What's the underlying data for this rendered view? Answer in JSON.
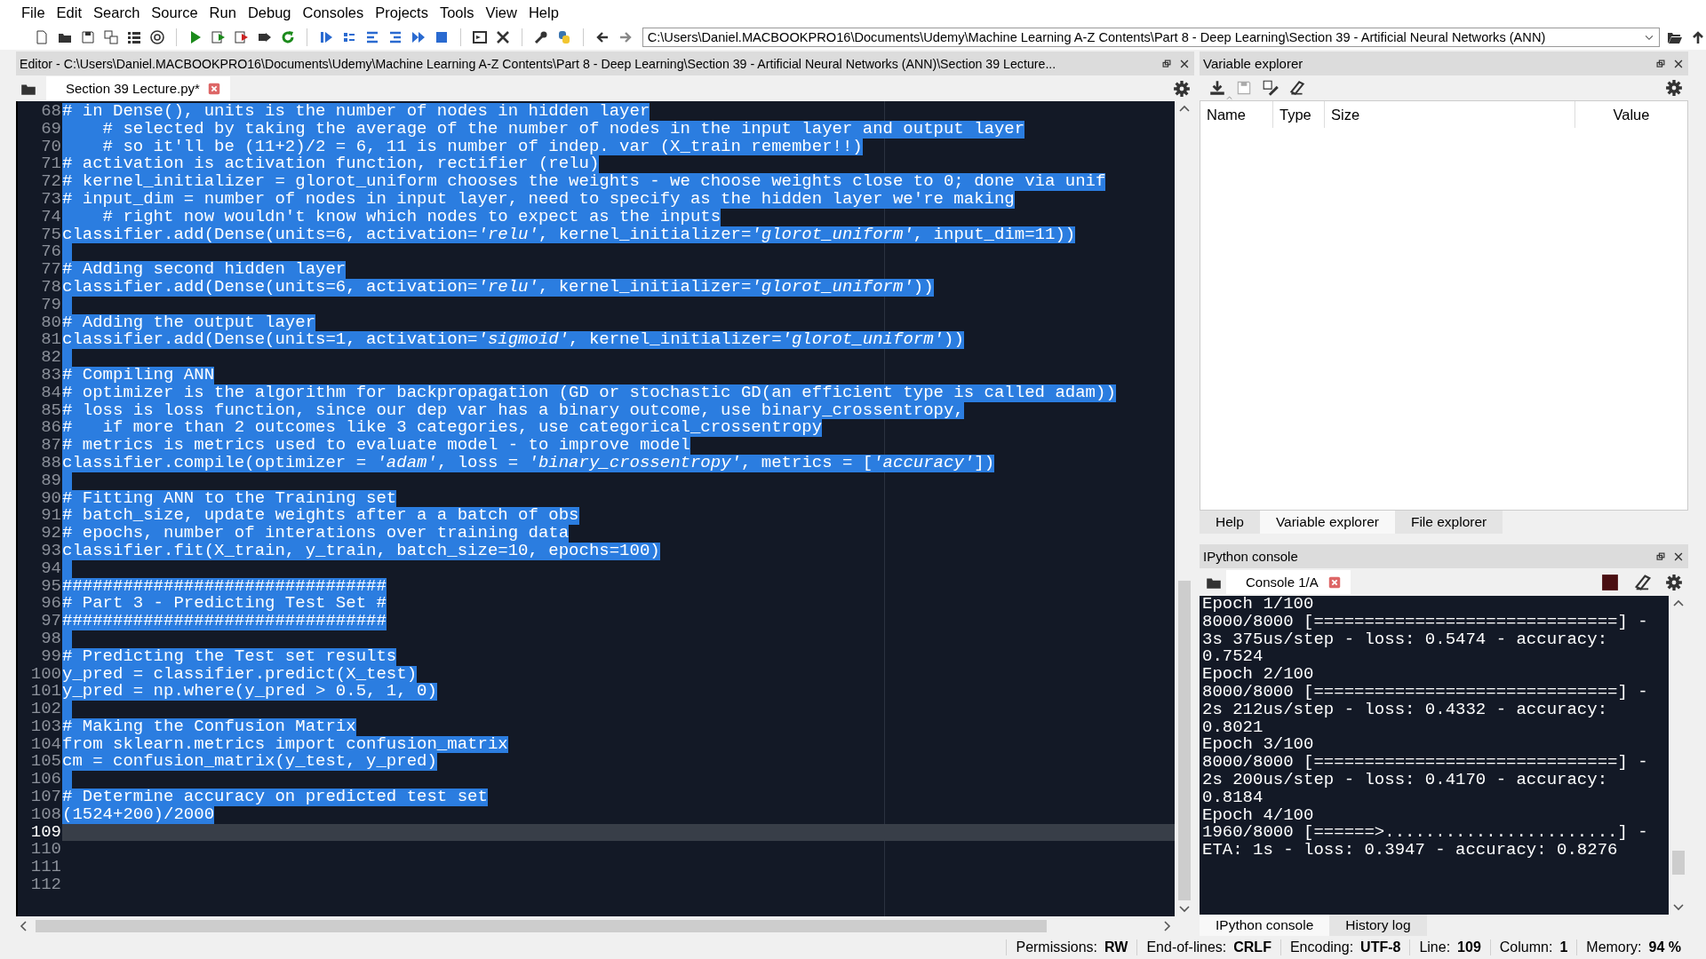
{
  "menu": [
    "File",
    "Edit",
    "Search",
    "Source",
    "Run",
    "Debug",
    "Consoles",
    "Projects",
    "Tools",
    "View",
    "Help"
  ],
  "path_field": {
    "value": "C:\\Users\\Daniel.MACBOOKPRO16\\Documents\\Udemy\\Machine Learning A-Z Contents\\Part 8 - Deep Learning\\Section 39 - Artificial Neural Networks (ANN)"
  },
  "editor": {
    "title": "Editor - C:\\Users\\Daniel.MACBOOKPRO16\\Documents\\Udemy\\Machine Learning A-Z Contents\\Part 8 - Deep Learning\\Section 39 - Artificial Neural Networks (ANN)\\Section 39 Lecture...",
    "tabs": [
      {
        "label": "Section 39 Lecture.py*",
        "selected": true
      }
    ],
    "lines": [
      {
        "number": "68",
        "text": "# in Dense(), units is the number of nodes in hidden layer",
        "selected": true,
        "current": false
      },
      {
        "number": "69",
        "text": "    # selected by taking the average of the number of nodes in the input layer and output layer",
        "selected": true,
        "current": false
      },
      {
        "number": "70",
        "text": "    # so it'll be (11+2)/2 = 6, 11 is number of indep. var (X_train remember!!)",
        "selected": true,
        "current": false
      },
      {
        "number": "71",
        "text": "# activation is activation function, rectifier (relu)",
        "selected": true,
        "current": false
      },
      {
        "number": "72",
        "text": "# kernel_initializer = glorot_uniform chooses the weights - we choose weights close to 0; done via unif",
        "selected": true,
        "current": false
      },
      {
        "number": "73",
        "text": "# input_dim = number of nodes in input layer, need to specify as the hidden layer we're making",
        "selected": true,
        "current": false
      },
      {
        "number": "74",
        "text": "    # right now wouldn't know which nodes to expect as the inputs",
        "selected": true,
        "current": false
      },
      {
        "number": "75",
        "text": "classifier.add(Dense(units=6, activation=*'relu'*, kernel_initializer=*'glorot_uniform'*, input_dim=11))",
        "selected": true,
        "current": false
      },
      {
        "number": "76",
        "selected": true,
        "current": false
      },
      {
        "number": "77",
        "text": "# Adding second hidden layer",
        "selected": true,
        "current": false
      },
      {
        "number": "78",
        "text": "classifier.add(Dense(units=6, activation=*'relu'*, kernel_initializer=*'glorot_uniform'*))",
        "selected": true,
        "current": false
      },
      {
        "number": "79",
        "selected": true,
        "current": false
      },
      {
        "number": "80",
        "text": "# Adding the output layer",
        "selected": true,
        "current": false
      },
      {
        "number": "81",
        "text": "classifier.add(Dense(units=1, activation=*'sigmoid'*, kernel_initializer=*'glorot_uniform'*))",
        "selected": true,
        "current": false
      },
      {
        "number": "82",
        "selected": true,
        "current": false
      },
      {
        "number": "83",
        "text": "# Compiling ANN",
        "selected": true,
        "current": false
      },
      {
        "number": "84",
        "text": "# optimizer is the algorithm for backpropagation (GD or stochastic GD(an efficient type is called adam))",
        "selected": true,
        "current": false
      },
      {
        "number": "85",
        "text": "# loss is loss function, since our dep var has a binary outcome, use binary_crossentropy,",
        "selected": true,
        "current": false
      },
      {
        "number": "86",
        "text": "#   if more than 2 outcomes like 3 categories, use categorical_crossentropy",
        "selected": true,
        "current": false
      },
      {
        "number": "87",
        "text": "# metrics is metrics used to evaluate model - to improve model",
        "selected": true,
        "current": false
      },
      {
        "number": "88",
        "text": "classifier.compile(optimizer = *'adam'*, loss = *'binary_crossentropy'*, metrics = [*'accuracy'*])",
        "selected": true,
        "current": false
      },
      {
        "number": "89",
        "selected": true,
        "current": false
      },
      {
        "number": "90",
        "text": "# Fitting ANN to the Training set",
        "selected": true,
        "current": false
      },
      {
        "number": "91",
        "text": "# batch_size, update weights after a a batch of obs",
        "selected": true,
        "current": false
      },
      {
        "number": "92",
        "text": "# epochs, number of interations over training data",
        "selected": true,
        "current": false
      },
      {
        "number": "93",
        "text": "classifier.fit(X_train, y_train, batch_size=10, epochs=100)",
        "selected": true,
        "current": false
      },
      {
        "number": "94",
        "selected": true,
        "current": false
      },
      {
        "number": "95",
        "text": "################################",
        "selected": true,
        "current": false
      },
      {
        "number": "96",
        "text": "# Part 3 - Predicting Test Set #",
        "selected": true,
        "current": false
      },
      {
        "number": "97",
        "text": "################################",
        "selected": true,
        "current": false
      },
      {
        "number": "98",
        "selected": true,
        "current": false
      },
      {
        "number": "99",
        "text": "# Predicting the Test set results",
        "selected": true,
        "current": false
      },
      {
        "number": "100",
        "text": "y_pred = classifier.predict(X_test)",
        "selected": true,
        "current": false
      },
      {
        "number": "101",
        "text": "y_pred = np.where(y_pred > 0.5, 1, 0)",
        "selected": true,
        "current": false
      },
      {
        "number": "102",
        "selected": true,
        "current": false
      },
      {
        "number": "103",
        "text": "# Making the Confusion Matrix",
        "selected": true,
        "current": false
      },
      {
        "number": "104",
        "text": "from sklearn.metrics import confusion_matrix",
        "selected": true,
        "current": false
      },
      {
        "number": "105",
        "text": "cm = confusion_matrix(y_test, y_pred)",
        "selected": true,
        "current": false
      },
      {
        "number": "106",
        "selected": true,
        "current": false
      },
      {
        "number": "107",
        "text": "# Determine accuracy on predicted test set",
        "selected": true,
        "current": false
      },
      {
        "number": "108",
        "text": "(1524+200)/2000",
        "selected": true,
        "current": false
      },
      {
        "number": "109",
        "selected": false,
        "current": true
      },
      {
        "number": "110",
        "selected": false,
        "current": false
      },
      {
        "number": "111",
        "selected": false,
        "current": false
      },
      {
        "number": "112",
        "selected": false,
        "current": false
      }
    ]
  },
  "variable_explorer": {
    "title": "Variable explorer",
    "columns": [
      "Name",
      "Type",
      "Size",
      "Value"
    ],
    "tabs": [
      {
        "label": "Help",
        "selected": false
      },
      {
        "label": "Variable explorer",
        "selected": true
      },
      {
        "label": "File explorer",
        "selected": false
      }
    ]
  },
  "console": {
    "title": "IPython console",
    "tabs": [
      {
        "label": "Console 1/A",
        "selected": true
      }
    ],
    "lines": [
      "Epoch 1/100",
      "8000/8000 [==============================] -",
      "3s 375us/step - loss: 0.5474 - accuracy:",
      "0.7524",
      "Epoch 2/100",
      "8000/8000 [==============================] -",
      "2s 212us/step - loss: 0.4332 - accuracy:",
      "0.8021",
      "Epoch 3/100",
      "8000/8000 [==============================] -",
      "2s 200us/step - loss: 0.4170 - accuracy:",
      "0.8184",
      "Epoch 4/100",
      "1960/8000 [======>.......................] -",
      "ETA: 1s - loss: 0.3947 - accuracy: 0.8276"
    ],
    "bottom_tabs": [
      {
        "label": "IPython console",
        "selected": true
      },
      {
        "label": "History log",
        "selected": false
      }
    ]
  },
  "status_bar": [
    {
      "label": "Permissions:",
      "value": "RW"
    },
    {
      "label": "End-of-lines:",
      "value": "CRLF"
    },
    {
      "label": "Encoding:",
      "value": "UTF-8"
    },
    {
      "label": "Line:",
      "value": "109"
    },
    {
      "label": "Column:",
      "value": "1"
    },
    {
      "label": "Memory:",
      "value": "94 %"
    }
  ]
}
